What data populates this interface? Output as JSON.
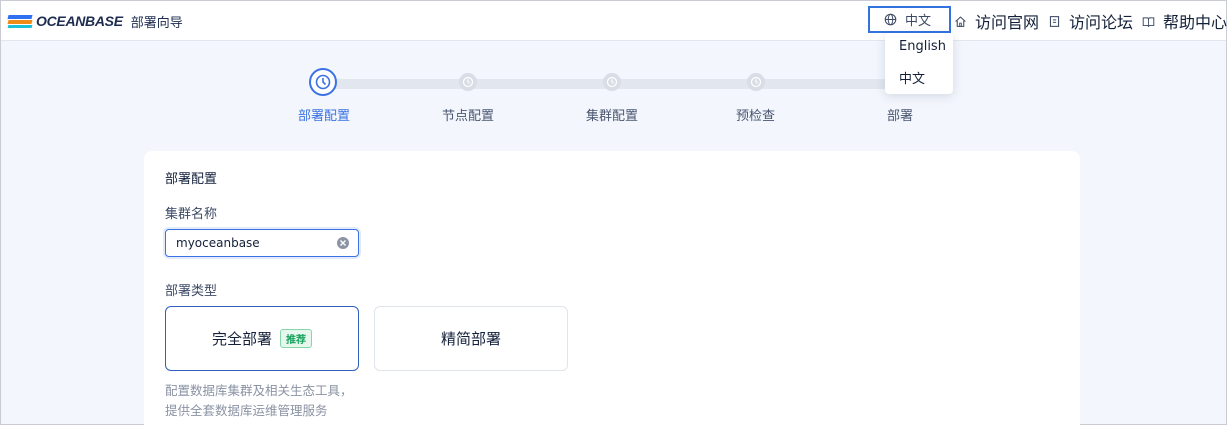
{
  "header": {
    "brand": "OCEANBASE",
    "subtitle": "部署向导",
    "language_button": "中文",
    "nav": [
      {
        "label": "访问官网",
        "icon": "home-icon"
      },
      {
        "label": "访问论坛",
        "icon": "forum-icon"
      },
      {
        "label": "帮助中心",
        "icon": "book-icon"
      }
    ]
  },
  "language_dropdown": {
    "options": [
      "English",
      "中文"
    ]
  },
  "steps": [
    {
      "label": "部署配置",
      "active": true
    },
    {
      "label": "节点配置",
      "active": false
    },
    {
      "label": "集群配置",
      "active": false
    },
    {
      "label": "预检查",
      "active": false
    },
    {
      "label": "部署",
      "active": false
    }
  ],
  "form": {
    "section_title": "部署配置",
    "cluster_name_label": "集群名称",
    "cluster_name_value": "myoceanbase",
    "deploy_type_label": "部署类型",
    "deploy_types": [
      {
        "label": "完全部署",
        "badge": "推荐",
        "selected": true
      },
      {
        "label": "精简部署",
        "badge": "",
        "selected": false
      }
    ],
    "description_lines": [
      "配置数据库集群及相关生态工具，",
      "提供全套数据库运维管理服务"
    ]
  },
  "colors": {
    "accent": "#3a72e3",
    "badge_green": "#18a35d",
    "page_bg": "#f3f6fc"
  }
}
